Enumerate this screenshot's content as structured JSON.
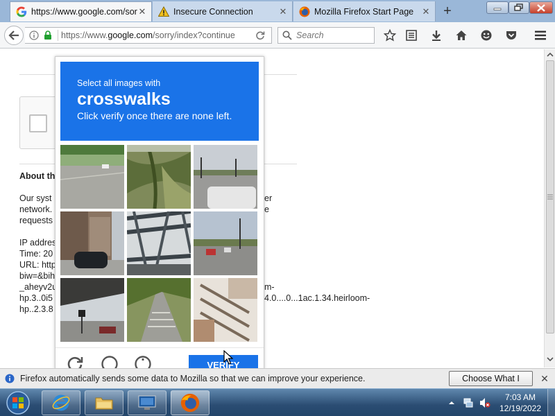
{
  "browser": {
    "tabs": [
      {
        "title": "https://www.google.com/sorry/index?",
        "close": "✕",
        "active": true
      },
      {
        "title": "Insecure Connection",
        "close": "✕",
        "active": false
      },
      {
        "title": "Mozilla Firefox Start Page",
        "close": "✕",
        "active": false
      }
    ],
    "new_tab": "+",
    "url": {
      "prefix": "https://www.",
      "host": "google.com",
      "rest": "/sorry/index?continue"
    },
    "search_placeholder": "Search"
  },
  "page": {
    "about_heading": "About th",
    "para_lines": [
      "Our syst",
      "network.",
      "requests"
    ],
    "para_right": [
      "er",
      "e"
    ],
    "info_lines": [
      "IP addres",
      "Time: 20",
      "URL: http",
      "biw=&bih",
      "_aheyv2u",
      "hp.3..0i5",
      "hp..2.3.8"
    ],
    "info_right": [
      "m-",
      "4.0....0...1ac.1.34.heirloom-"
    ]
  },
  "captcha": {
    "line1": "Select all images with",
    "keyword": "crosswalks",
    "line3": "Click verify once there are none left.",
    "verify_label": "VERIFY",
    "accent": "#1a73e8"
  },
  "notification": {
    "text": "Firefox automatically sends some data to Mozilla so that we can improve your experience.",
    "button": "Choose What I Share",
    "close": "✕"
  },
  "taskbar": {
    "time": "7:03 AM",
    "date": "12/19/2022"
  }
}
